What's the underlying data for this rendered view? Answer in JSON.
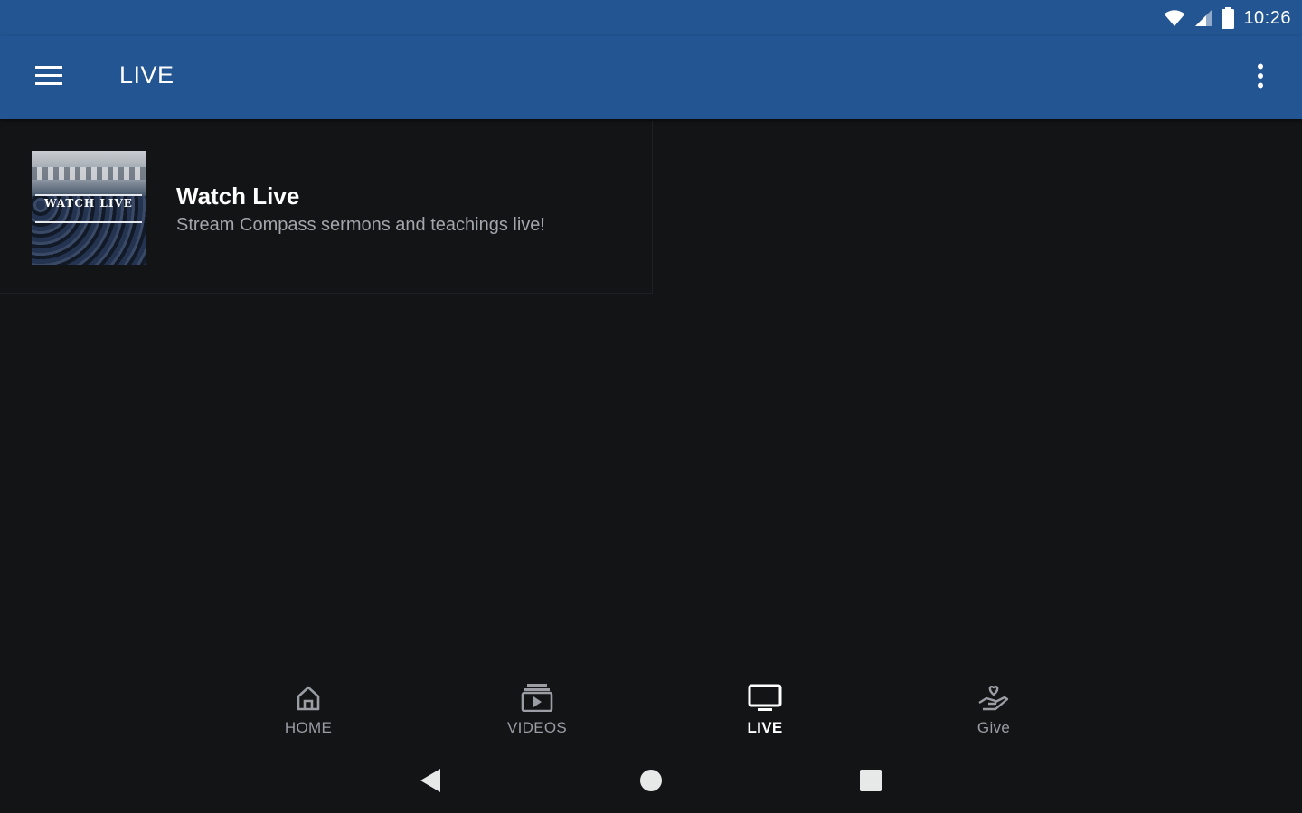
{
  "status_bar": {
    "time": "10:26",
    "icons": [
      "wifi-icon",
      "cell-signal-icon",
      "battery-icon"
    ]
  },
  "app_bar": {
    "title": "LIVE",
    "menu_icon": "hamburger-menu-icon",
    "overflow_icon": "more-vert-icon"
  },
  "live_item": {
    "thumbnail_text": "WATCH LIVE",
    "title": "Watch Live",
    "subtitle": "Stream Compass sermons and teachings live!"
  },
  "bottom_nav": {
    "items": [
      {
        "label": "HOME",
        "icon": "home-icon",
        "active": false
      },
      {
        "label": "VIDEOS",
        "icon": "video-library-icon",
        "active": false
      },
      {
        "label": "LIVE",
        "icon": "tv-icon",
        "active": true
      },
      {
        "label": "Give",
        "icon": "give-hand-heart-icon",
        "active": false
      }
    ]
  },
  "system_nav": {
    "buttons": [
      "back-icon",
      "home-circle-icon",
      "recents-square-icon"
    ]
  },
  "colors": {
    "primary": "#235592",
    "background": "#131416",
    "inactive": "#9a9ea4",
    "active": "#ffffff"
  }
}
